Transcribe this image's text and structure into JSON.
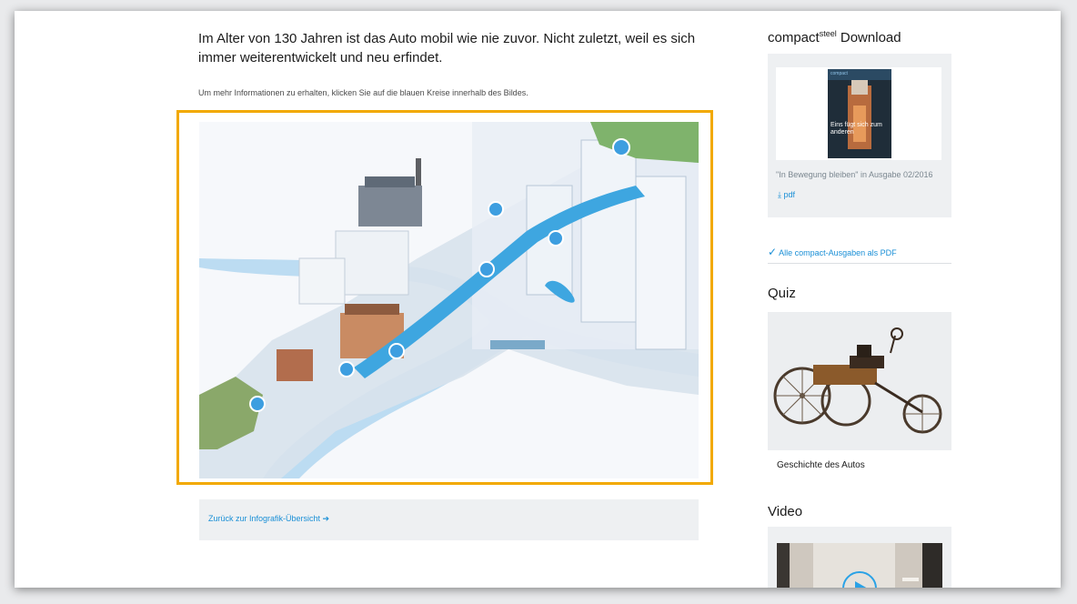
{
  "main": {
    "intro": "Im Alter von 130 Jahren ist das Auto mobil wie nie zuvor. Nicht zuletzt, weil es sich immer weiterentwickelt und neu erfindet.",
    "hint": "Um mehr Informationen zu erhalten, klicken Sie auf die blauen Kreise innerhalb des Bildes.",
    "back_link": "Zurück zur Infografik-Übersicht ➔"
  },
  "sidebar": {
    "download": {
      "heading_prefix": "compact",
      "heading_sup": "steel",
      "heading_suffix": " Download",
      "cover_logo": "compact",
      "cover_title": "Eins fügt sich zum anderen",
      "issue_text": "\"In Bewegung bleiben\" in Ausgabe 02/2016",
      "pdf_label": "pdf"
    },
    "all_issues_link": "Alle compact-Ausgaben als PDF",
    "quiz": {
      "heading": "Quiz",
      "caption": "Geschichte des Autos"
    },
    "video": {
      "heading": "Video"
    }
  },
  "colors": {
    "accent_frame": "#f2a900",
    "link_blue": "#1a8fd6",
    "hotspot_blue": "#3d9ee0",
    "card_bg": "#eef0f2"
  },
  "icons": {
    "download": "download-icon",
    "check": "check-icon",
    "play": "play-icon",
    "hotspot": "hotspot-circle"
  }
}
